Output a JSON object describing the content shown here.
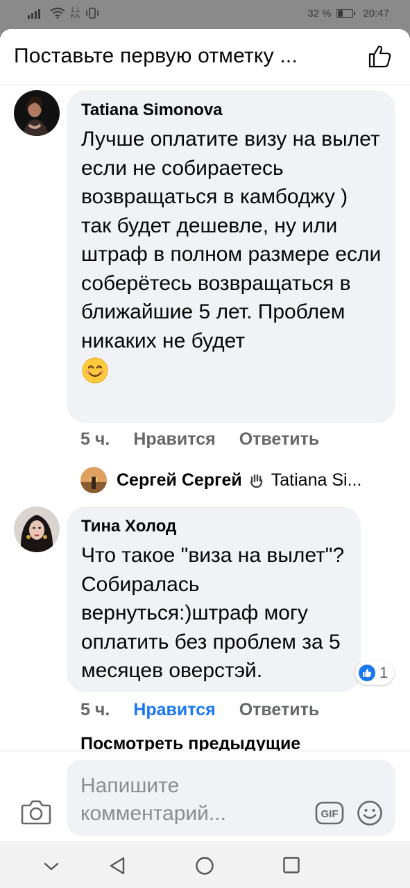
{
  "status_bar": {
    "net_speed_value": "1.1",
    "net_speed_unit": "K/s",
    "battery_percent": "32 %",
    "battery_level": 0.32,
    "time": "20:47"
  },
  "header": {
    "title": "Поставьте первую отметку ...",
    "like_icon": "thumbs-up-outline-icon"
  },
  "comments": [
    {
      "author": "Tatiana Simonova",
      "text": "Лучше оплатите визу на вылет если не собираетесь возвращаться в камбоджу ) так будет дешевле, ну или штраф в полном размере если соберётесь возвращаться в ближайшие 5 лет. Проблем никаких не будет",
      "emoji": "😊",
      "time": "5 ч.",
      "like_label": "Нравится",
      "reply_label": "Ответить",
      "reply": {
        "author": "Сергей Сергей",
        "target": "Tatiana Si..."
      }
    },
    {
      "author": "Тина Холод",
      "text": "Что такое \"виза на вылет\"?Собиралась вернуться:)штраф могу оплатить без проблем за 5 месяцев оверстэй.",
      "time": "5 ч.",
      "like_label": "Нравится",
      "reply_label": "Ответить",
      "reaction_count": "1",
      "liked": true
    }
  ],
  "view_previous": "Посмотреть предыдущие",
  "composer": {
    "placeholder": "Напишите комментарий...",
    "gif_label": "GIF"
  },
  "colors": {
    "accent": "#1877f2",
    "bubble": "#f0f2f5",
    "meta_text": "#65676b"
  }
}
